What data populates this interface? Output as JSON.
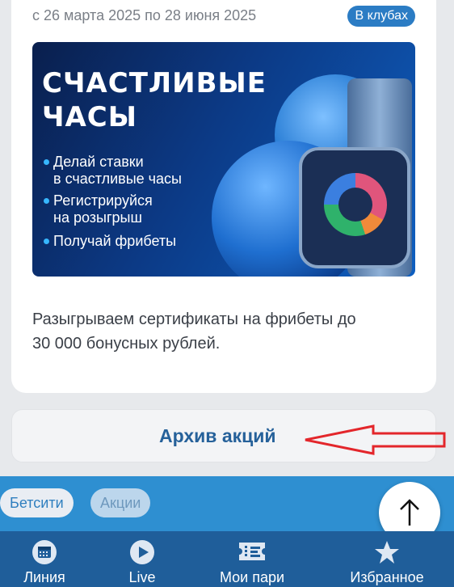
{
  "promo": {
    "date_range": "с 26 марта 2025 по 28 июня 2025",
    "badge": "В клубах",
    "banner": {
      "title_line1": "СЧАСТЛИВЫЕ",
      "title_line2": "ЧАСЫ",
      "bullets": [
        {
          "line1": "Делай ставки",
          "line2": "в счастливые часы"
        },
        {
          "line1": "Регистрируйся",
          "line2": "на розыгрыш"
        },
        {
          "line1": "Получай фрибеты",
          "line2": ""
        }
      ]
    },
    "description_line1": "Разыгрываем сертификаты на фрибеты до",
    "description_line2": "30 000 бонусных рублей."
  },
  "archive": {
    "label": "Архив акций"
  },
  "breadcrumb": {
    "chips": [
      "Бетсити",
      "Акции"
    ]
  },
  "tabs": [
    {
      "label": "Линия",
      "icon": "calendar-icon"
    },
    {
      "label": "Live",
      "icon": "play-icon"
    },
    {
      "label": "Мои пари",
      "icon": "ticket-icon"
    },
    {
      "label": "Избранное",
      "icon": "star-icon"
    }
  ],
  "colors": {
    "accent": "#2b7cc4",
    "tabbar": "#1f5e9a",
    "strip": "#2e8fd1",
    "annotation_arrow": "#e3262b"
  }
}
